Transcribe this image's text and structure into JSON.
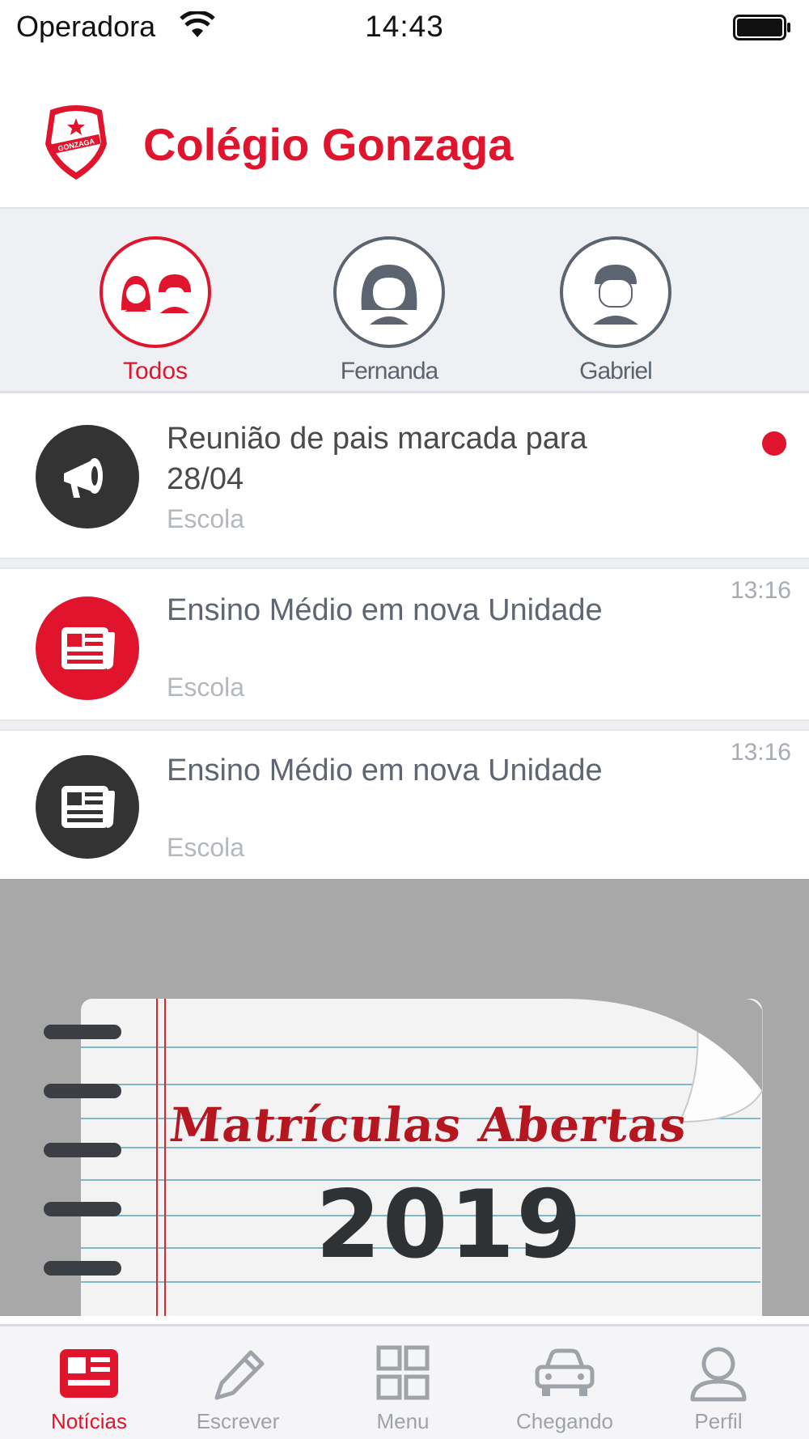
{
  "status_bar": {
    "carrier": "Operadora",
    "time": "14:43"
  },
  "header": {
    "title": "Colégio Gonzaga",
    "logo_text": "GONZAGA"
  },
  "profiles": [
    {
      "label": "Todos",
      "icon": "group-icon",
      "active": true
    },
    {
      "label": "Fernanda",
      "icon": "girl-avatar-icon",
      "active": false
    },
    {
      "label": "Gabriel",
      "icon": "boy-avatar-icon",
      "active": false
    }
  ],
  "news": [
    {
      "title": "Reunião de pais marcada para 28/04",
      "source": "Escola",
      "time": "",
      "icon": "megaphone-icon",
      "icon_color": "#333333",
      "unread": true
    },
    {
      "title": "Ensino Médio em nova Unidade",
      "source": "Escola",
      "time": "13:16",
      "icon": "newspaper-icon",
      "icon_color": "#e0152d",
      "unread": false
    },
    {
      "title": "Ensino Médio em nova Unidade",
      "source": "Escola",
      "time": "13:16",
      "icon": "newspaper-icon",
      "icon_color": "#333333",
      "unread": false
    }
  ],
  "banner": {
    "line1": "Matrículas Abertas",
    "line2": "2019"
  },
  "tabs": [
    {
      "label": "Notícias",
      "icon": "news-icon",
      "active": true
    },
    {
      "label": "Escrever",
      "icon": "pencil-icon",
      "active": false
    },
    {
      "label": "Menu",
      "icon": "grid-icon",
      "active": false
    },
    {
      "label": "Chegando",
      "icon": "car-icon",
      "active": false
    },
    {
      "label": "Perfil",
      "icon": "person-icon",
      "active": false
    }
  ],
  "colors": {
    "brand": "#e0152d",
    "dark": "#333333",
    "muted": "#9ea3aa"
  }
}
